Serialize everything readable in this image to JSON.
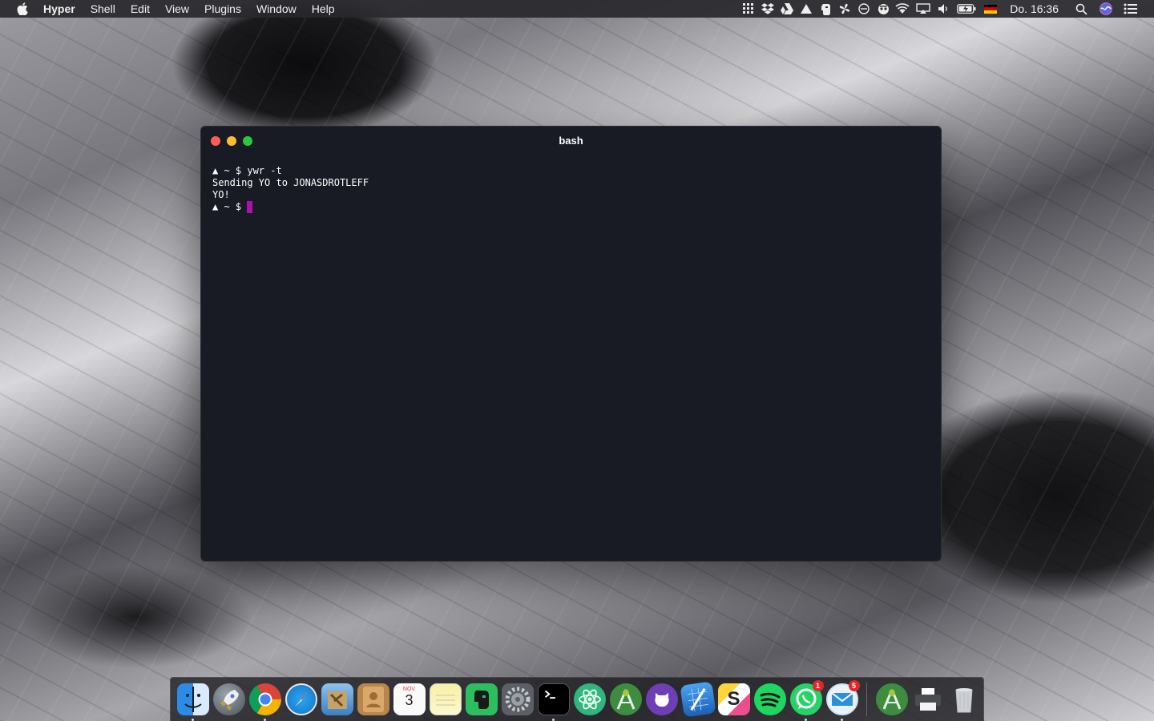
{
  "menubar": {
    "app_name": "Hyper",
    "items": [
      "Shell",
      "Edit",
      "View",
      "Plugins",
      "Window",
      "Help"
    ],
    "status_icons": [
      "grid-icon",
      "dropbox-icon",
      "drive-icon",
      "vercel-icon",
      "evernote-icon",
      "fan-icon",
      "timemachine-icon",
      "spy-icon",
      "wifi-icon",
      "airplay-icon",
      "volume-icon",
      "battery-charging-icon",
      "german-flag-icon",
      "spotlight-icon",
      "siri-icon",
      "notification-center-icon"
    ],
    "clock": "Do. 16:36"
  },
  "terminal": {
    "title": "bash",
    "lines": [
      "▲ ~ $ ywr -t",
      "Sending YO to JONASDROTLEFF",
      "YO!",
      "▲ ~ $ "
    ],
    "cursor_color": "#b00fb0"
  },
  "colors": {
    "terminal_bg": "#181b23",
    "close": "#fc5e57",
    "minimize": "#febc2e",
    "zoom": "#29c840"
  },
  "dock": {
    "apps": [
      {
        "icon": "finder-icon",
        "running": true
      },
      {
        "icon": "launchpad-icon",
        "running": false
      },
      {
        "icon": "chrome-icon",
        "running": true
      },
      {
        "icon": "safari-icon",
        "running": false
      },
      {
        "icon": "mail-icon",
        "running": false
      },
      {
        "icon": "contacts-icon",
        "running": false
      },
      {
        "icon": "calendar-icon",
        "running": false,
        "month": "NOV",
        "day": "3"
      },
      {
        "icon": "notes-icon",
        "running": false
      },
      {
        "icon": "evernote-icon",
        "running": false
      },
      {
        "icon": "system-preferences-icon",
        "running": false
      },
      {
        "icon": "hyper-terminal-icon",
        "running": true
      },
      {
        "icon": "atom-icon",
        "running": false
      },
      {
        "icon": "android-studio-icon",
        "running": false
      },
      {
        "icon": "github-desktop-icon",
        "running": false
      },
      {
        "icon": "xcode-icon",
        "running": false
      },
      {
        "icon": "sketch-icon",
        "running": false
      },
      {
        "icon": "spotify-icon",
        "running": false
      },
      {
        "icon": "whatsapp-icon",
        "running": true,
        "badge": "1"
      },
      {
        "icon": "airmail-icon",
        "running": true,
        "badge": "5"
      }
    ],
    "other": [
      {
        "icon": "android-studio-icon",
        "running": false
      },
      {
        "icon": "printer-icon",
        "running": false
      },
      {
        "icon": "trash-icon",
        "running": false
      }
    ]
  }
}
